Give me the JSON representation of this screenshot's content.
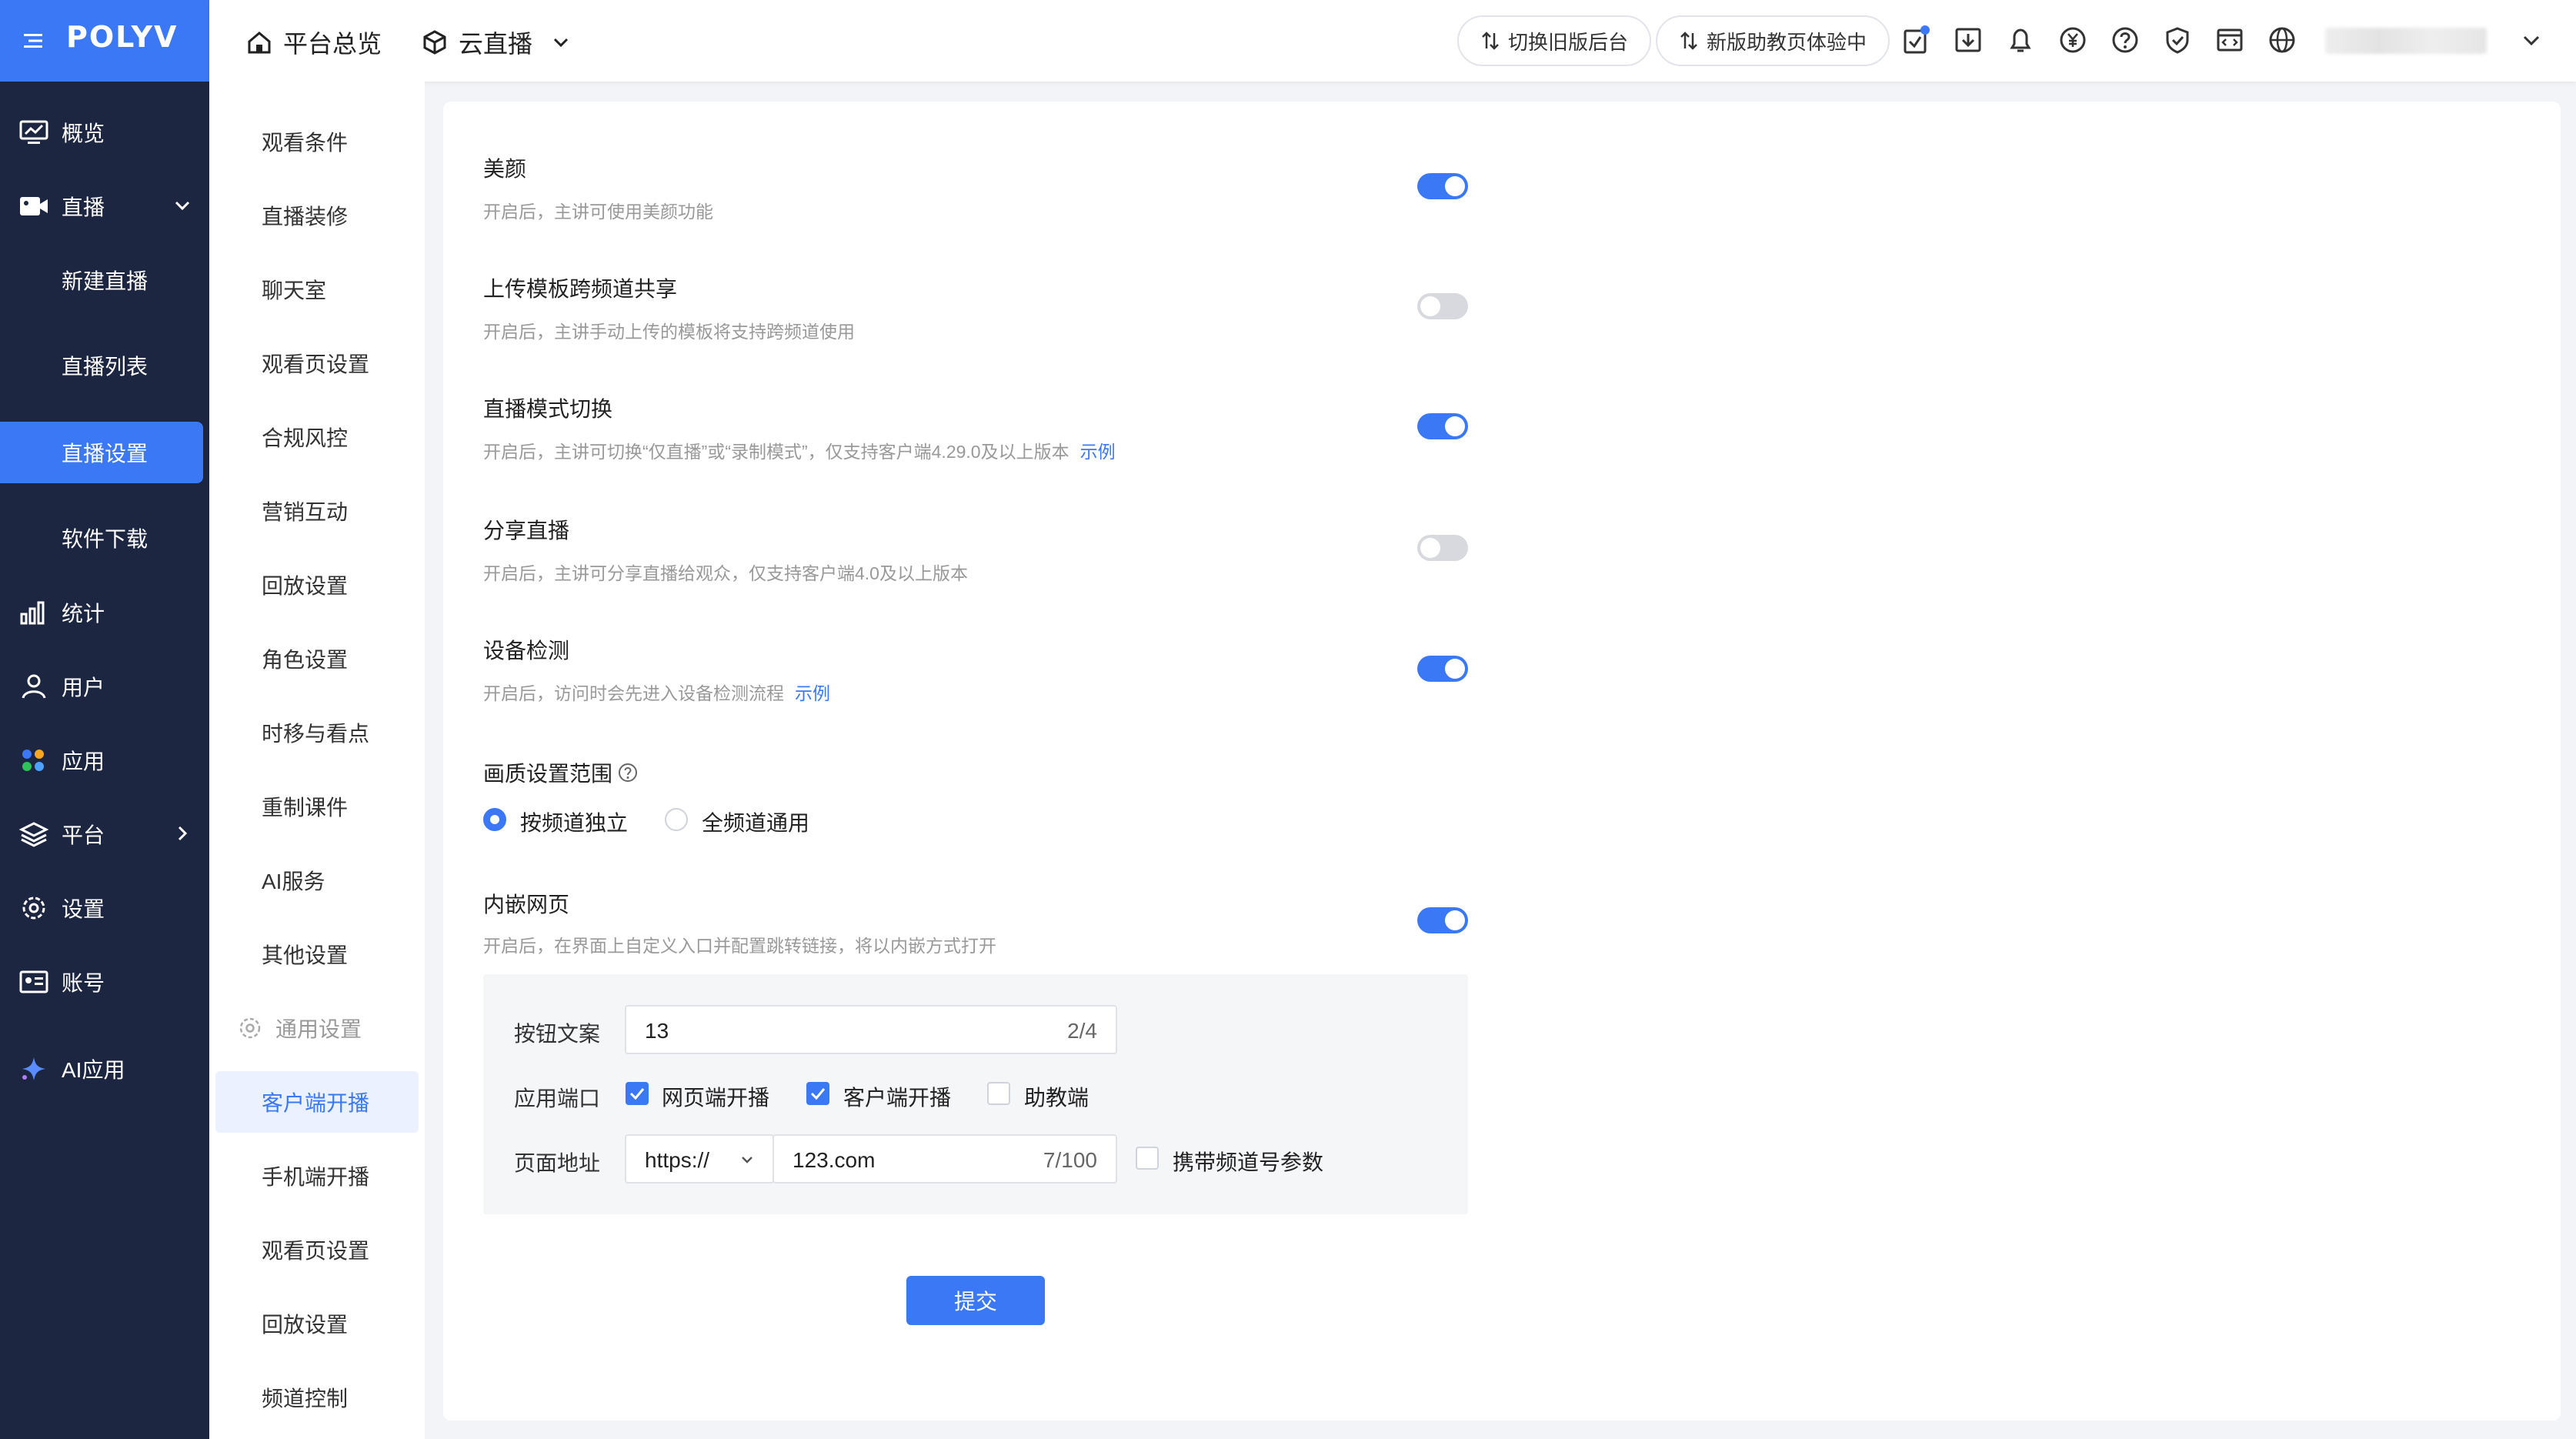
{
  "brand": {
    "logo": "POLYV",
    "accent": "#3b78f6",
    "sidebar_bg": "#1c2640"
  },
  "header": {
    "overview": "平台总览",
    "product": "云直播",
    "switch_old": "切换旧版后台",
    "new_assistant": "新版助教页体验中",
    "tool_icons": [
      "task-icon",
      "download-icon",
      "bell-icon",
      "yuan-icon",
      "help-icon",
      "shield-icon",
      "code-icon",
      "globe-icon"
    ]
  },
  "sidebar": {
    "items": [
      {
        "label": "概览",
        "icon": "monitor-icon"
      },
      {
        "label": "直播",
        "icon": "video-icon"
      },
      {
        "label": "新建直播"
      },
      {
        "label": "直播列表"
      },
      {
        "label": "直播设置"
      },
      {
        "label": "软件下载"
      },
      {
        "label": "统计",
        "icon": "bar-chart-icon"
      },
      {
        "label": "用户",
        "icon": "user-icon"
      },
      {
        "label": "应用",
        "icon": "apps-icon"
      },
      {
        "label": "平台",
        "icon": "layers-icon"
      },
      {
        "label": "设置",
        "icon": "gear-icon"
      },
      {
        "label": "账号",
        "icon": "id-card-icon"
      },
      {
        "label": "AI应用",
        "icon": "sparkle-icon"
      }
    ]
  },
  "subnav": {
    "items": [
      "观看条件",
      "直播装修",
      "聊天室",
      "观看页设置",
      "合规风控",
      "营销互动",
      "回放设置",
      "角色设置",
      "时移与看点",
      "重制课件",
      "AI服务",
      "其他设置"
    ],
    "group": "通用设置",
    "group_items": [
      "客户端开播",
      "手机端开播",
      "观看页设置",
      "回放设置",
      "频道控制"
    ]
  },
  "settings": {
    "beauty": {
      "title": "美颜",
      "desc": "开启后，主讲可使用美颜功能",
      "on": true
    },
    "template_share": {
      "title": "上传模板跨频道共享",
      "desc": "开启后，主讲手动上传的模板将支持跨频道使用",
      "on": false
    },
    "mode_switch": {
      "title": "直播模式切换",
      "desc": "开启后，主讲可切换“仅直播”或“录制模式”，仅支持客户端4.29.0及以上版本",
      "link": "示例",
      "on": true
    },
    "share_live": {
      "title": "分享直播",
      "desc": "开启后，主讲可分享直播给观众，仅支持客户端4.0及以上版本",
      "on": false
    },
    "device_check": {
      "title": "设备检测",
      "desc": "开启后，访问时会先进入设备检测流程",
      "link": "示例",
      "on": true
    },
    "quality_scope": {
      "title": "画质设置范围",
      "options": [
        "按频道独立",
        "全频道通用"
      ],
      "selected": "按频道独立"
    },
    "embed_page": {
      "title": "内嵌网页",
      "desc": "开启后，在界面上自定义入口并配置跳转链接，将以内嵌方式打开",
      "on": true,
      "button_text_label": "按钮文案",
      "button_text_value": "13",
      "button_text_count": "2/4",
      "endpoint_label": "应用端口",
      "endpoints": [
        {
          "label": "网页端开播",
          "checked": true
        },
        {
          "label": "客户端开播",
          "checked": true
        },
        {
          "label": "助教端",
          "checked": false
        }
      ],
      "url_label": "页面地址",
      "protocol": "https://",
      "url_value": "123.com",
      "url_count": "7/100",
      "carry_param_label": "携带频道号参数",
      "carry_param_checked": false
    }
  },
  "submit_label": "提交"
}
